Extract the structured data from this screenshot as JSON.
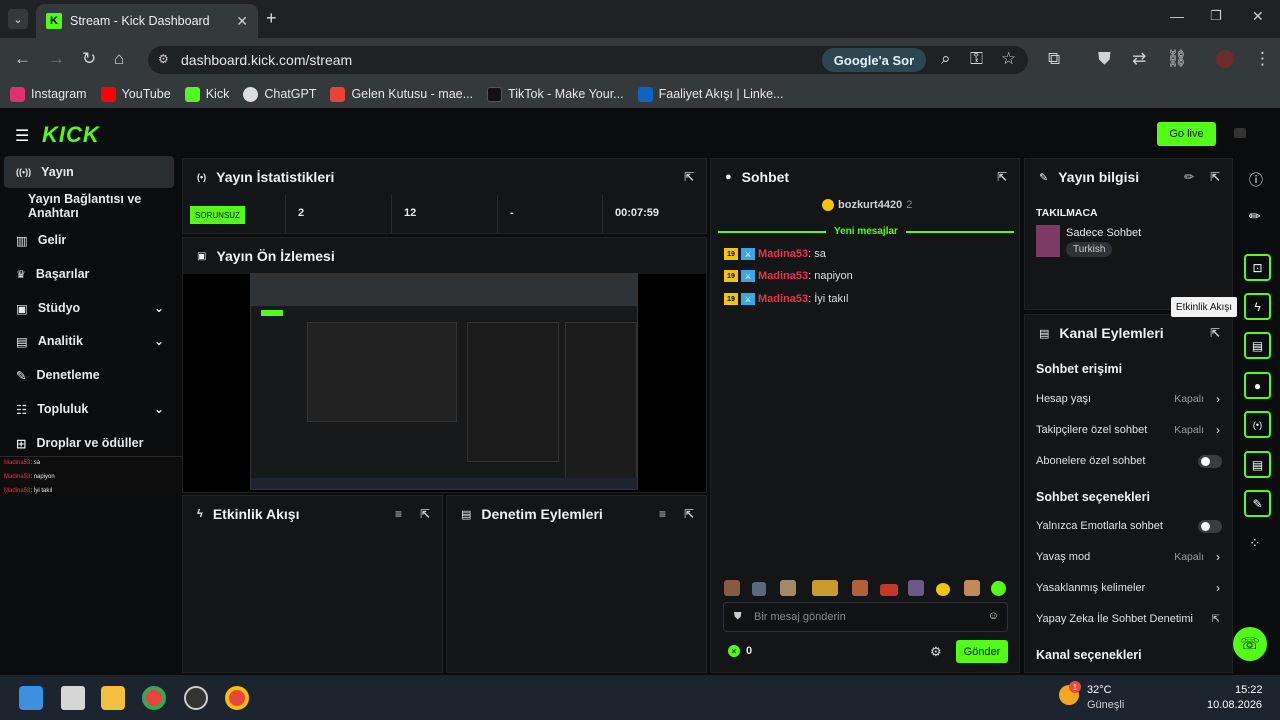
{
  "browser": {
    "tab_title": "Stream - Kick Dashboard",
    "tab_close": "✕",
    "new_tab": "+",
    "url": "dashboard.kick.com/stream",
    "google_ask": "Google'a Sor",
    "bookmarks": [
      {
        "label": "Instagram",
        "color": "#e1306c"
      },
      {
        "label": "YouTube",
        "color": "#ff0000"
      },
      {
        "label": "Kick",
        "color": "#53fc18"
      },
      {
        "label": "ChatGPT",
        "color": "#dddddd"
      },
      {
        "label": "Gelen Kutusu - mae...",
        "color": "#ea4335"
      },
      {
        "label": "TikTok - Make Your...",
        "color": "#111111"
      },
      {
        "label": "Faaliyet Akışı | Linke...",
        "color": "#0a66c2"
      }
    ]
  },
  "kick": {
    "logo": "KICK",
    "go_live": "Go live"
  },
  "sidebar": {
    "items": [
      {
        "label": "Yayın",
        "icon": "broadcast-icon",
        "glyph": "((•))"
      },
      {
        "label": "Yayın Bağlantısı ve Anahtarı",
        "icon": "",
        "glyph": ""
      },
      {
        "label": "Gelir",
        "icon": "chart-icon",
        "glyph": "▥"
      },
      {
        "label": "Başarılar",
        "icon": "trophy-icon",
        "glyph": "🏆"
      },
      {
        "label": "Stüdyo",
        "icon": "studio-icon",
        "glyph": "▣"
      },
      {
        "label": "Analitik",
        "icon": "analytics-icon",
        "glyph": "▤"
      },
      {
        "label": "Denetleme",
        "icon": "wrench-icon",
        "glyph": "🔧"
      },
      {
        "label": "Topluluk",
        "icon": "community-icon",
        "glyph": "👥"
      },
      {
        "label": "Droplar ve ödüller",
        "icon": "gift-icon",
        "glyph": "🎁"
      }
    ],
    "overlay_chat": [
      {
        "name": "Madina53",
        "text": "sa"
      },
      {
        "name": "Madina53",
        "text": "napiyon"
      },
      {
        "name": "Madina53",
        "text": "İyi takıl"
      }
    ]
  },
  "stats": {
    "title": "Yayın İstatistikleri",
    "status_badge": "SORUNSUZ",
    "values": [
      "2",
      "12",
      "-",
      "00:07:59"
    ]
  },
  "preview": {
    "title": "Yayın Ön İzlemesi"
  },
  "activity": {
    "title": "Etkinlik Akışı"
  },
  "moderation": {
    "title": "Denetim Eylemleri"
  },
  "chat": {
    "title": "Sohbet",
    "pinned_user": "bozkurt4420",
    "pinned_count": "2",
    "new_messages": "Yeni mesajlar",
    "messages": [
      {
        "badge": "19",
        "name": "Madina53",
        "text": ": sa"
      },
      {
        "badge": "19",
        "name": "Madina53",
        "text": ": napiyon"
      },
      {
        "badge": "19",
        "name": "Madina53",
        "text": ": İyi takıl"
      }
    ],
    "input_placeholder": "Bir mesaj gönderin",
    "viewer_count": "0",
    "send_label": "Gönder"
  },
  "stream_info": {
    "title": "Yayın bilgisi",
    "stream_title": "TAKILMACA",
    "category": "Sadece Sohbet",
    "language_tag": "Turkish"
  },
  "channel_actions": {
    "title": "Kanal Eylemleri",
    "chat_access": "Sohbet erişimi",
    "account_age": "Hesap yaşı",
    "followers_only": "Takipçilere özel sohbet",
    "subscribers_only": "Abonelere özel sohbet",
    "chat_options": "Sohbet seçenekleri",
    "emotes_only": "Yalnızca Emotlarla sohbet",
    "slow_mode": "Yavaş mod",
    "banned_words": "Yasaklanmış kelimeler",
    "ai_moderation": "Yapay Zeka İle Sohbet Denetimi",
    "channel_options": "Kanal seçenekleri",
    "off_label": "Kapalı"
  },
  "rail": {
    "tooltip": "Etkinlik Akışı"
  },
  "taskbar": {
    "temperature": "32°C",
    "weather": "Güneşli",
    "time": "15:22",
    "date": "10.08.2026",
    "weather_badge": "1"
  }
}
